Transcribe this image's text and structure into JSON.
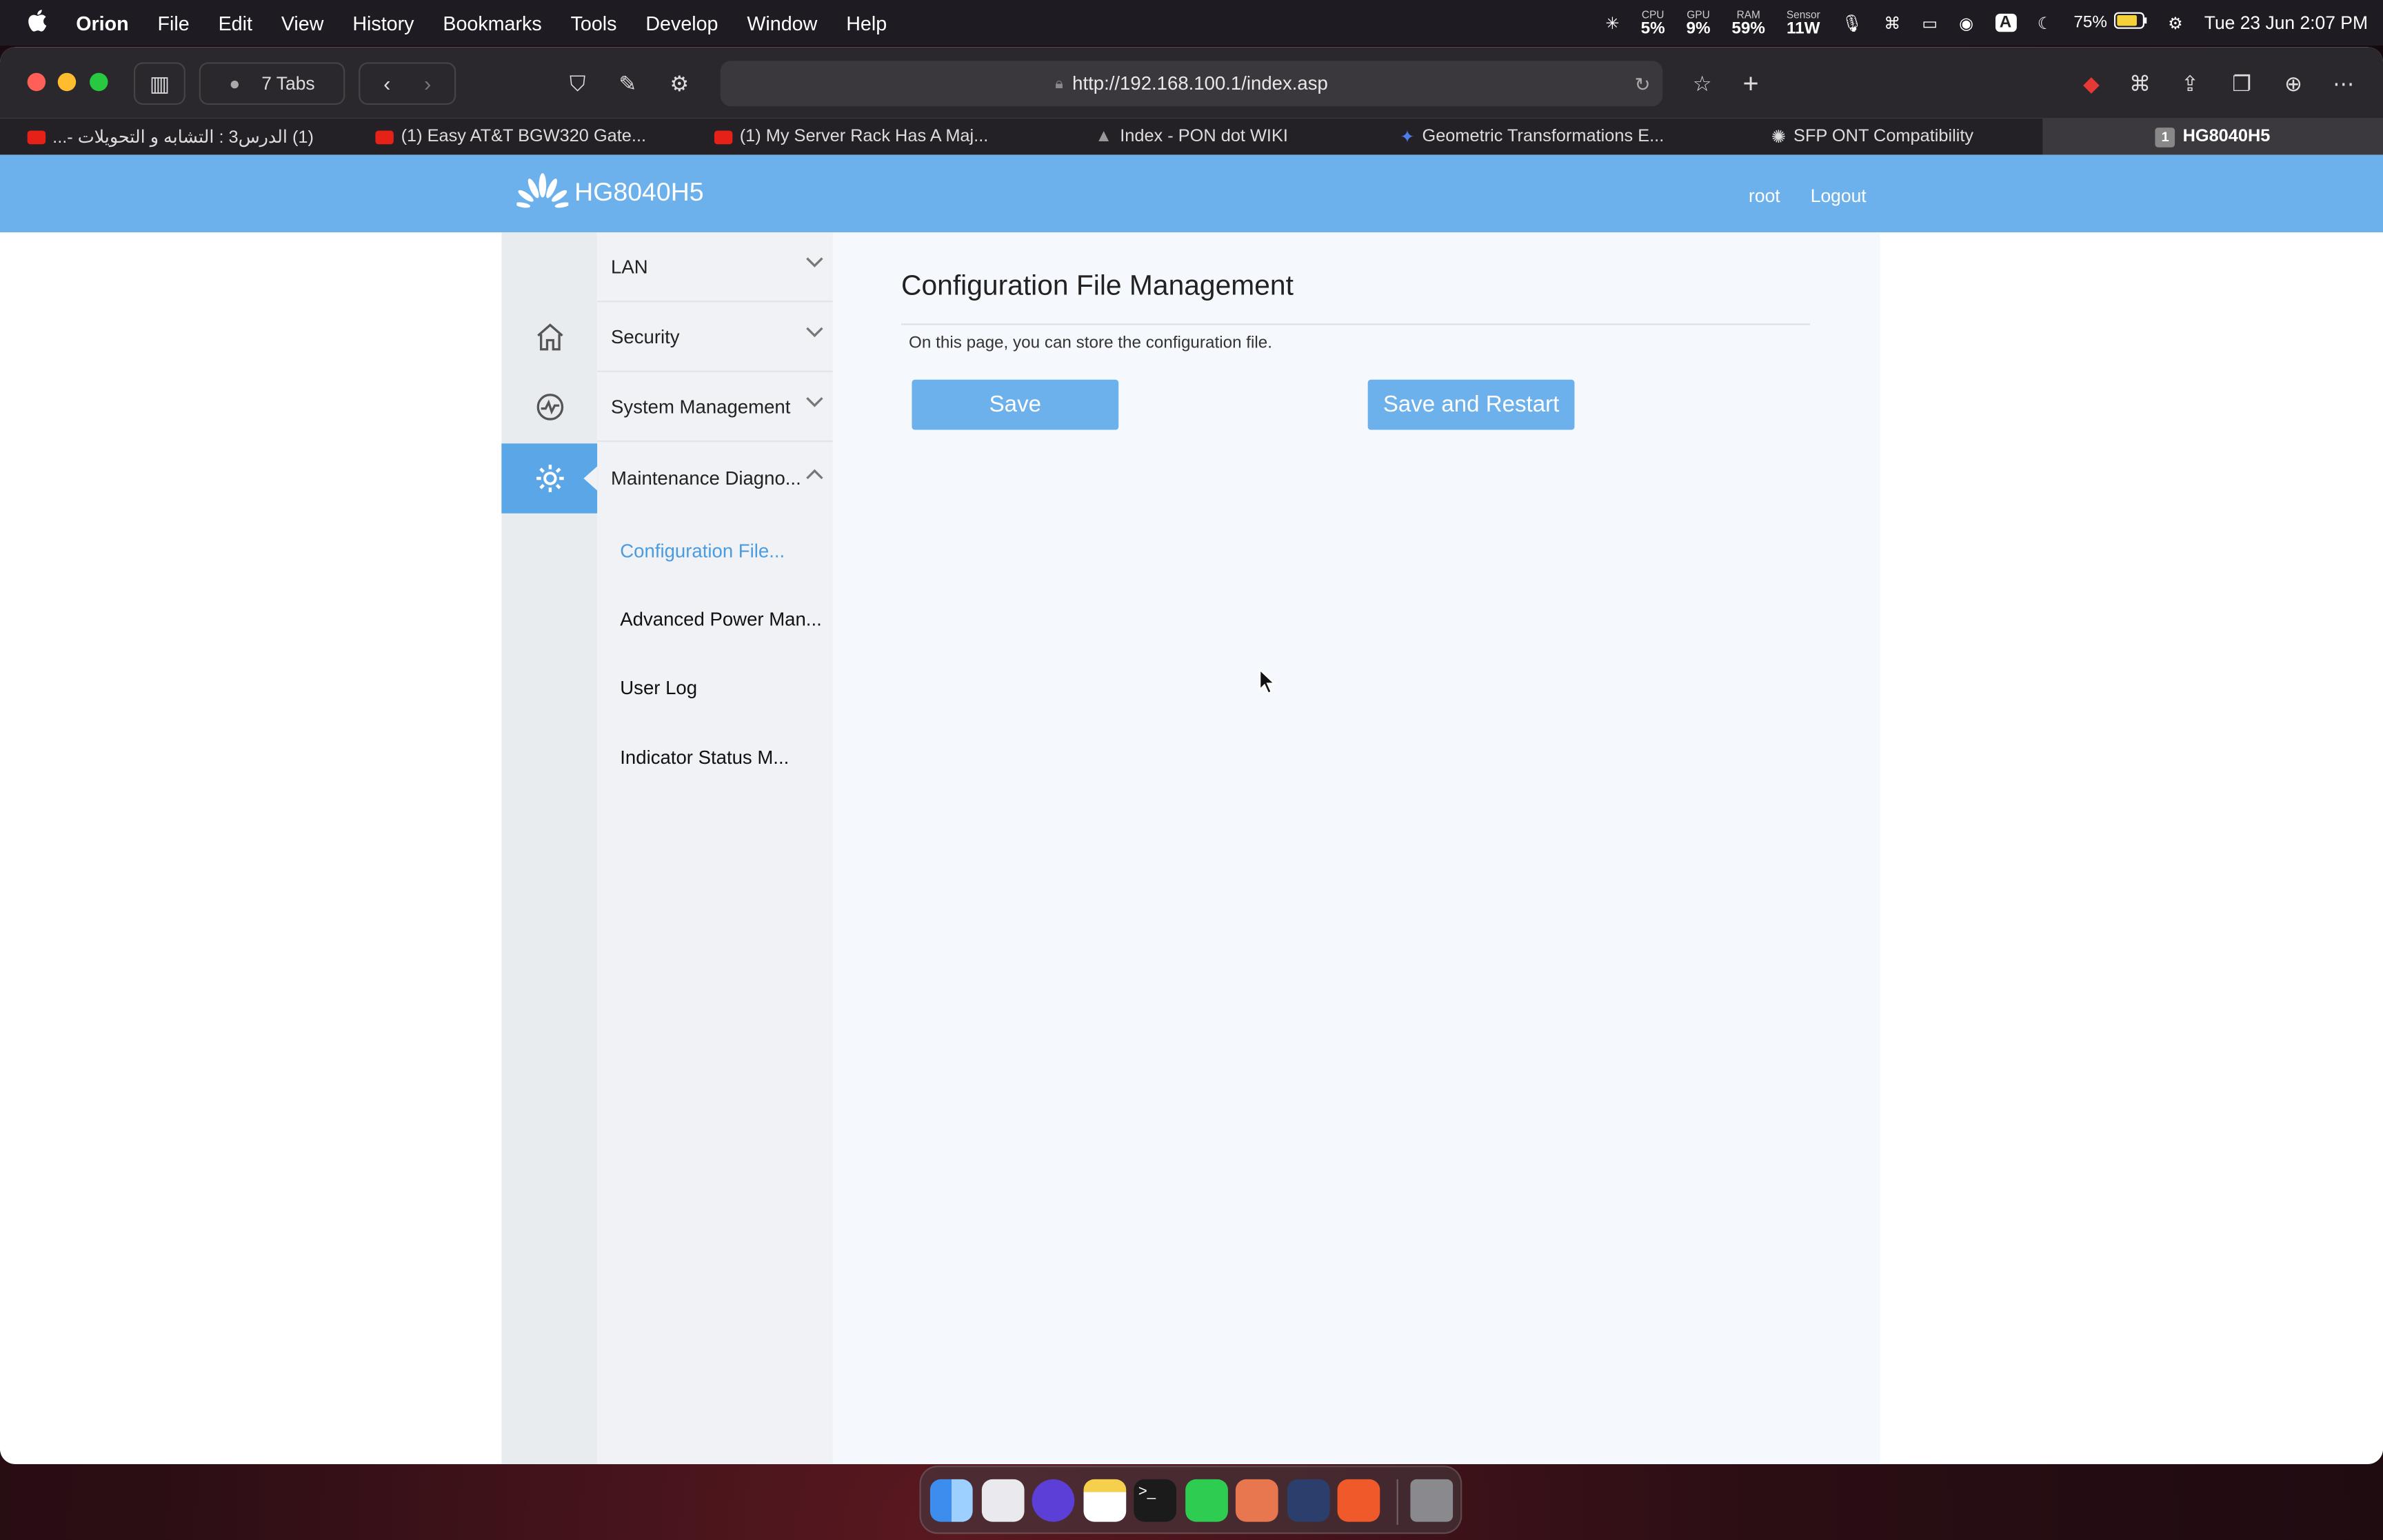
{
  "menubar": {
    "app_name": "Orion",
    "items": [
      "File",
      "Edit",
      "View",
      "History",
      "Bookmarks",
      "Tools",
      "Develop",
      "Window",
      "Help"
    ],
    "stats": [
      {
        "label": "CPU",
        "value": "5%"
      },
      {
        "label": "GPU",
        "value": "9%"
      },
      {
        "label": "RAM",
        "value": "59%"
      },
      {
        "label": "Sensor",
        "value": "11W"
      }
    ],
    "battery": "75%",
    "datetime": "Tue 23 Jun  2:07 PM"
  },
  "browser": {
    "tab_count_label": "7 Tabs",
    "url": "http://192.168.100.1/index.asp",
    "tabs": [
      {
        "title": "(1) الدرس3 : التشابه و التحويلات -...",
        "favicon_color": "#e62117"
      },
      {
        "title": "(1) Easy AT&T BGW320 Gate...",
        "favicon_color": "#e62117"
      },
      {
        "title": "(1) My Server Rack Has A Maj...",
        "favicon_color": "#e62117"
      },
      {
        "title": "Index - PON dot WIKI",
        "favicon_color": "#999999"
      },
      {
        "title": "Geometric Transformations E...",
        "favicon_color": "#4f7de8"
      },
      {
        "title": "SFP ONT Compatibility",
        "favicon_color": "#dddddd"
      },
      {
        "title": "HG8040H5",
        "favicon_color": "#888888",
        "active": true
      }
    ]
  },
  "router": {
    "model": "HG8040H5",
    "user": "root",
    "logout": "Logout",
    "nav": [
      {
        "label": "LAN",
        "expanded": false
      },
      {
        "label": "Security",
        "expanded": false
      },
      {
        "label": "System Management",
        "expanded": false
      },
      {
        "label": "Maintenance Diagno...",
        "expanded": true
      }
    ],
    "subnav": [
      {
        "label": "Configuration File...",
        "selected": true
      },
      {
        "label": "Advanced Power Man...",
        "selected": false
      },
      {
        "label": "User Log",
        "selected": false
      },
      {
        "label": "Indicator Status M...",
        "selected": false
      }
    ],
    "page_title": "Configuration File Management",
    "description": "On this page, you can store the configuration file.",
    "save_button": "Save",
    "save_restart_button": "Save and Restart",
    "accent_color": "#6cb1ec"
  },
  "dock": {
    "apps": [
      "finder",
      "launchpad",
      "safari-like",
      "notes",
      "terminal",
      "whatsapp",
      "claude",
      "davinci",
      "brave",
      "trash"
    ]
  }
}
